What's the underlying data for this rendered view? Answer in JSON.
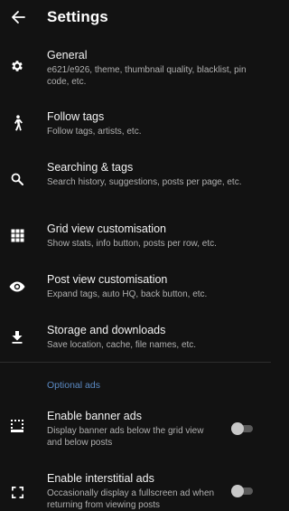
{
  "header": {
    "title": "Settings"
  },
  "items": [
    {
      "title": "General",
      "desc": "e621/e926, theme, thumbnail quality, blacklist, pin code, etc."
    },
    {
      "title": "Follow tags",
      "desc": "Follow tags, artists, etc."
    },
    {
      "title": "Searching & tags",
      "desc": "Search history, suggestions, posts per page, etc."
    },
    {
      "title": "Grid view customisation",
      "desc": "Show stats, info button, posts per row, etc."
    },
    {
      "title": "Post view customisation",
      "desc": "Expand tags, auto HQ, back button, etc."
    },
    {
      "title": "Storage and downloads",
      "desc": "Save location, cache, file names, etc."
    }
  ],
  "ads_section": {
    "header": "Optional ads",
    "banner": {
      "title": "Enable banner ads",
      "desc": "Display banner ads below the grid view and below posts",
      "enabled": false
    },
    "interstitial": {
      "title": "Enable interstitial ads",
      "desc": "Occasionally display a fullscreen ad when returning from viewing posts",
      "enabled": false
    }
  },
  "colors": {
    "background": "#121212",
    "accent": "#5b8ac4",
    "text_secondary": "#b0b0b0"
  }
}
